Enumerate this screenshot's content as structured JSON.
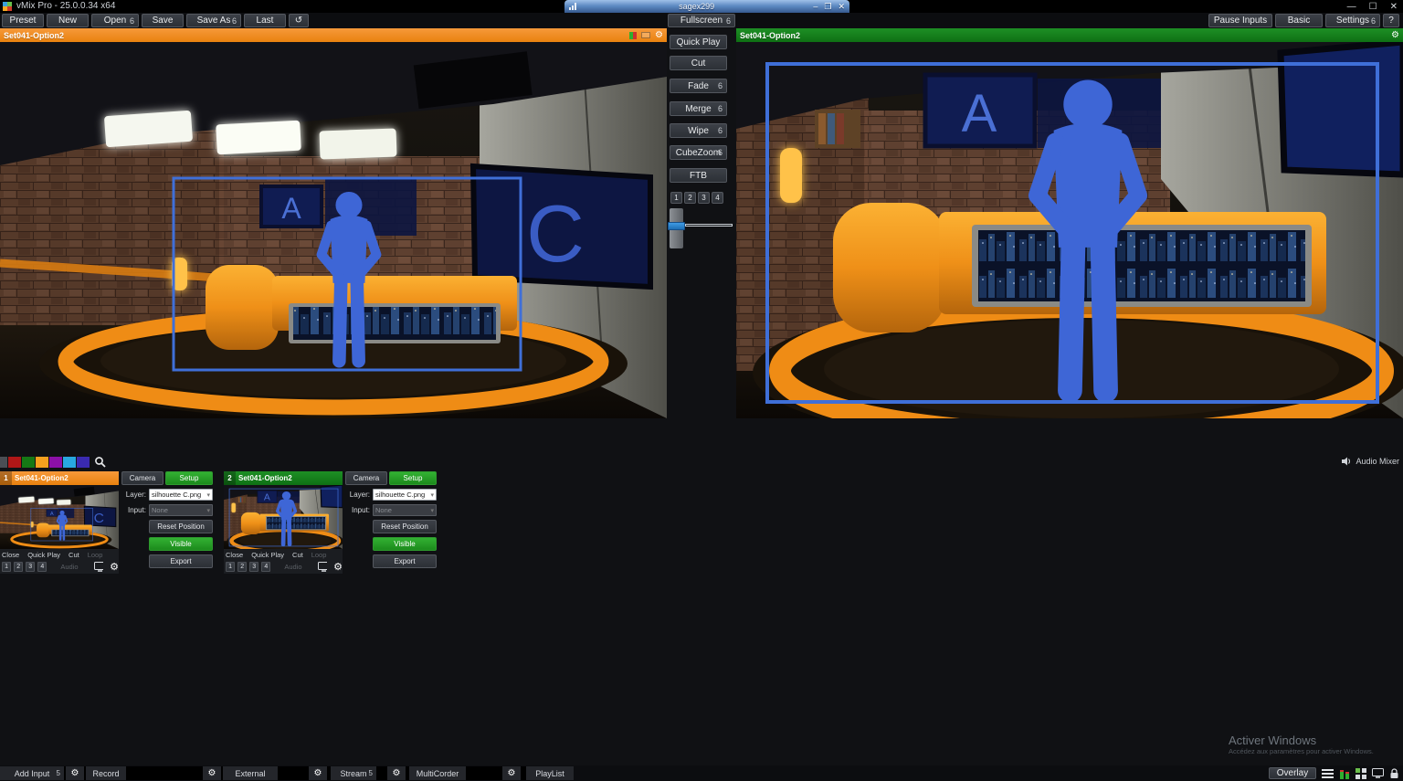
{
  "titlebar": {
    "app_title": "vMix Pro - 25.0.0.34 x64",
    "floating_window": {
      "title": "sagex299",
      "minimize": "–",
      "restore": "❐",
      "close": "✕"
    },
    "window_minimize": "—",
    "window_maximize": "☐",
    "window_close": "✕"
  },
  "toolbar": {
    "preset": "Preset",
    "new": "New",
    "open": "Open",
    "open_badge": "6",
    "save": "Save",
    "save_as": "Save As",
    "save_as_badge": "6",
    "last": "Last",
    "loop_icon": "↺",
    "pause_inputs": "Pause Inputs",
    "basic": "Basic",
    "settings": "Settings",
    "settings_badge": "6",
    "help": "?"
  },
  "preview": {
    "title": "Set041-Option2",
    "accent": "#F18A21"
  },
  "program": {
    "title": "Set041-Option2",
    "accent": "#15801C"
  },
  "transition_panel": {
    "fullscreen": "Fullscreen",
    "fullscreen_badge": "6",
    "buttons": [
      {
        "label": "Quick Play",
        "badge": ""
      },
      {
        "label": "Cut",
        "badge": ""
      },
      {
        "label": "Fade",
        "badge": "6"
      },
      {
        "label": "Merge",
        "badge": "6"
      },
      {
        "label": "Wipe",
        "badge": "6"
      },
      {
        "label": "CubeZoom",
        "badge": "6"
      },
      {
        "label": "FTB",
        "badge": ""
      }
    ],
    "quick_numbers": [
      "1",
      "2",
      "3",
      "4"
    ]
  },
  "scene": {
    "screen_letter_a": "A",
    "screen_letter_c": "C"
  },
  "audio_mixer": "Audio Mixer",
  "inputs": [
    {
      "number": "1",
      "title": "Set041-Option2",
      "close": "Close",
      "quick_play": "Quick Play",
      "cut": "Cut",
      "loop": "Loop",
      "numbers": [
        "1",
        "2",
        "3",
        "4"
      ],
      "audio": "Audio",
      "camera": "Camera",
      "setup": "Setup",
      "layer_label": "Layer:",
      "layer_value": "silhouette C.png",
      "input_label": "Input:",
      "input_value": "None",
      "reset_position": "Reset Position",
      "visible": "Visible",
      "export": "Export"
    },
    {
      "number": "2",
      "title": "Set041-Option2",
      "close": "Close",
      "quick_play": "Quick Play",
      "cut": "Cut",
      "loop": "Loop",
      "numbers": [
        "1",
        "2",
        "3",
        "4"
      ],
      "audio": "Audio",
      "camera": "Camera",
      "setup": "Setup",
      "layer_label": "Layer:",
      "layer_value": "silhouette C.png",
      "input_label": "Input:",
      "input_value": "None",
      "reset_position": "Reset Position",
      "visible": "Visible",
      "export": "Export"
    }
  ],
  "bottom_bar": {
    "add_input": "Add Input",
    "add_input_badge": "5",
    "record": "Record",
    "external": "External",
    "stream": "Stream",
    "stream_badge": "5",
    "multicorder": "MultiCorder",
    "playlist": "PlayList",
    "overlay": "Overlay"
  },
  "watermark": {
    "line1": "Activer Windows",
    "line2": "Accédez aux paramètres pour activer Windows."
  }
}
